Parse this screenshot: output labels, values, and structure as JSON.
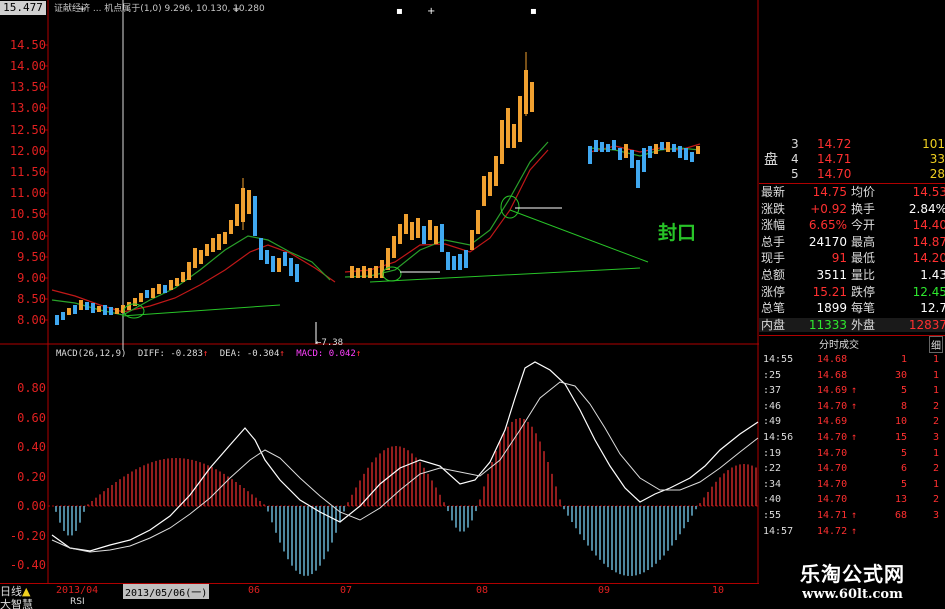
{
  "header": {
    "price_tag": "15.477",
    "legend_text": "证献经济 ... 机点属于(1,0) 9.296, 10.130, 10.280"
  },
  "chart": {
    "y_labels": [
      "14.50",
      "14.00",
      "13.50",
      "13.00",
      "12.50",
      "12.00",
      "11.50",
      "11.00",
      "10.50",
      "10.00",
      "9.50",
      "9.00",
      "8.50",
      "8.00"
    ],
    "annotation": "封口",
    "low_label": "7.38"
  },
  "macd": {
    "title": "MACD(26,12,9)",
    "diff_label": "DIFF:",
    "diff_value": "-0.283",
    "dea_label": "DEA:",
    "dea_value": "-0.304",
    "macd_label": "MACD:",
    "macd_value": "0.042",
    "y_labels": [
      "0.80",
      "0.60",
      "0.40",
      "0.20",
      "0.00",
      "-0.20",
      "-0.40"
    ]
  },
  "x_axis": {
    "months": [
      "2013/04",
      "06",
      "07",
      "08",
      "09",
      "10"
    ],
    "cursor_date": "2013/05/06(一)"
  },
  "bottom_tabs": {
    "period": "日线",
    "formula": "大智慧",
    "rsi": "RSI"
  },
  "order_book": {
    "pan_label": "盘",
    "rows": [
      {
        "level": "3",
        "price": "14.72",
        "vol": "101"
      },
      {
        "level": "4",
        "price": "14.71",
        "vol": "33"
      },
      {
        "level": "5",
        "price": "14.70",
        "vol": "28"
      }
    ]
  },
  "quote": {
    "rows": [
      {
        "l1": "最新",
        "v1": "14.75",
        "l2": "均价",
        "v2": "14.53",
        "c1": "#ff3030",
        "c2": "#ff3030"
      },
      {
        "l1": "涨跌",
        "v1": "+0.92",
        "l2": "换手",
        "v2": "2.84%",
        "c1": "#ff3030",
        "c2": "#ffffff"
      },
      {
        "l1": "涨幅",
        "v1": "6.65%",
        "l2": "今开",
        "v2": "14.40",
        "c1": "#ff3030",
        "c2": "#ff3030"
      },
      {
        "l1": "总手",
        "v1": "24170",
        "l2": "最高",
        "v2": "14.87",
        "c1": "#ffffff",
        "c2": "#ff3030"
      },
      {
        "l1": "现手",
        "v1": "91",
        "l2": "最低",
        "v2": "14.20",
        "c1": "#ff3030",
        "c2": "#ff3030"
      },
      {
        "l1": "总额",
        "v1": "3511",
        "l2": "量比",
        "v2": "1.43",
        "c1": "#ffffff",
        "c2": "#ffffff"
      },
      {
        "l1": "涨停",
        "v1": "15.21",
        "l2": "跌停",
        "v2": "12.45",
        "c1": "#ff3030",
        "c2": "#2ee82e"
      },
      {
        "l1": "总笔",
        "v1": "1899",
        "l2": "每笔",
        "v2": "12.7",
        "c1": "#ffffff",
        "c2": "#ffffff"
      },
      {
        "l1": "内盘",
        "v1": "11333",
        "l2": "外盘",
        "v2": "12837",
        "c1": "#2ee82e",
        "c2": "#ff3030"
      }
    ]
  },
  "ticks": {
    "header": "分时成交",
    "detail": "细",
    "rows": [
      {
        "time": "14:55",
        "price": "14.68",
        "arrow": "",
        "vol": "1",
        "n": "1"
      },
      {
        "time": ":25",
        "price": "14.68",
        "arrow": "",
        "vol": "30",
        "n": "1"
      },
      {
        "time": ":37",
        "price": "14.69",
        "arrow": "↑",
        "vol": "5",
        "n": "1"
      },
      {
        "time": ":46",
        "price": "14.70",
        "arrow": "↑",
        "vol": "8",
        "n": "2"
      },
      {
        "time": ":49",
        "price": "14.69",
        "arrow": "",
        "vol": "10",
        "n": "2"
      },
      {
        "time": "14:56",
        "price": "14.70",
        "arrow": "↑",
        "vol": "15",
        "n": "3"
      },
      {
        "time": ":19",
        "price": "14.70",
        "arrow": "",
        "vol": "5",
        "n": "1"
      },
      {
        "time": ":22",
        "price": "14.70",
        "arrow": "",
        "vol": "6",
        "n": "2"
      },
      {
        "time": ":34",
        "price": "14.70",
        "arrow": "",
        "vol": "5",
        "n": "1"
      },
      {
        "time": ":40",
        "price": "14.70",
        "arrow": "",
        "vol": "13",
        "n": "2"
      },
      {
        "time": ":55",
        "price": "14.71",
        "arrow": "↑",
        "vol": "68",
        "n": "3"
      },
      {
        "time": "14:57",
        "price": "14.72",
        "arrow": "↑",
        "vol": "",
        "n": ""
      }
    ]
  },
  "watermark": {
    "name": "乐淘公式网",
    "url": "www.60lt.com"
  },
  "colors": {
    "up": "#ff3030",
    "down": "#2ee82e",
    "grid": "#b00000",
    "candle_up": "#f0a030",
    "candle_down": "#40a8f0",
    "ma_red": "#c01818",
    "ma_green": "#2aa02a",
    "annotation": "#28c428"
  }
}
